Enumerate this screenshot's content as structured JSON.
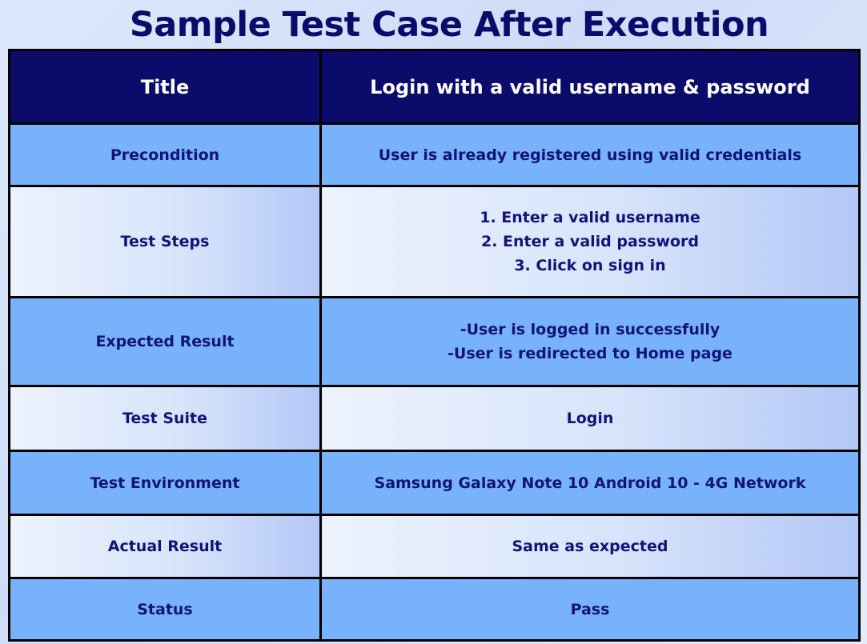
{
  "page": {
    "title": "Sample Test Case After Execution"
  },
  "test_case": {
    "rows": [
      {
        "label": "Title",
        "value": "Login with a valid username & password"
      },
      {
        "label": "Precondition",
        "value": "User is already registered using valid credentials"
      },
      {
        "label": "Test Steps",
        "lines": [
          "1. Enter a valid username",
          "2. Enter a valid password",
          "3. Click on sign in"
        ]
      },
      {
        "label": "Expected Result",
        "lines": [
          "-User is logged in successfully",
          "-User is redirected to Home page"
        ]
      },
      {
        "label": "Test Suite",
        "value": "Login"
      },
      {
        "label": "Test Environment",
        "value": "Samsung Galaxy Note 10 Android 10 - 4G Network"
      },
      {
        "label": "Actual Result",
        "value": "Same as expected"
      },
      {
        "label": "Status",
        "value": "Pass"
      }
    ]
  },
  "colors": {
    "navy": "#0b0b6b",
    "blue_row": "#78b2fb",
    "text": "#12137a"
  }
}
